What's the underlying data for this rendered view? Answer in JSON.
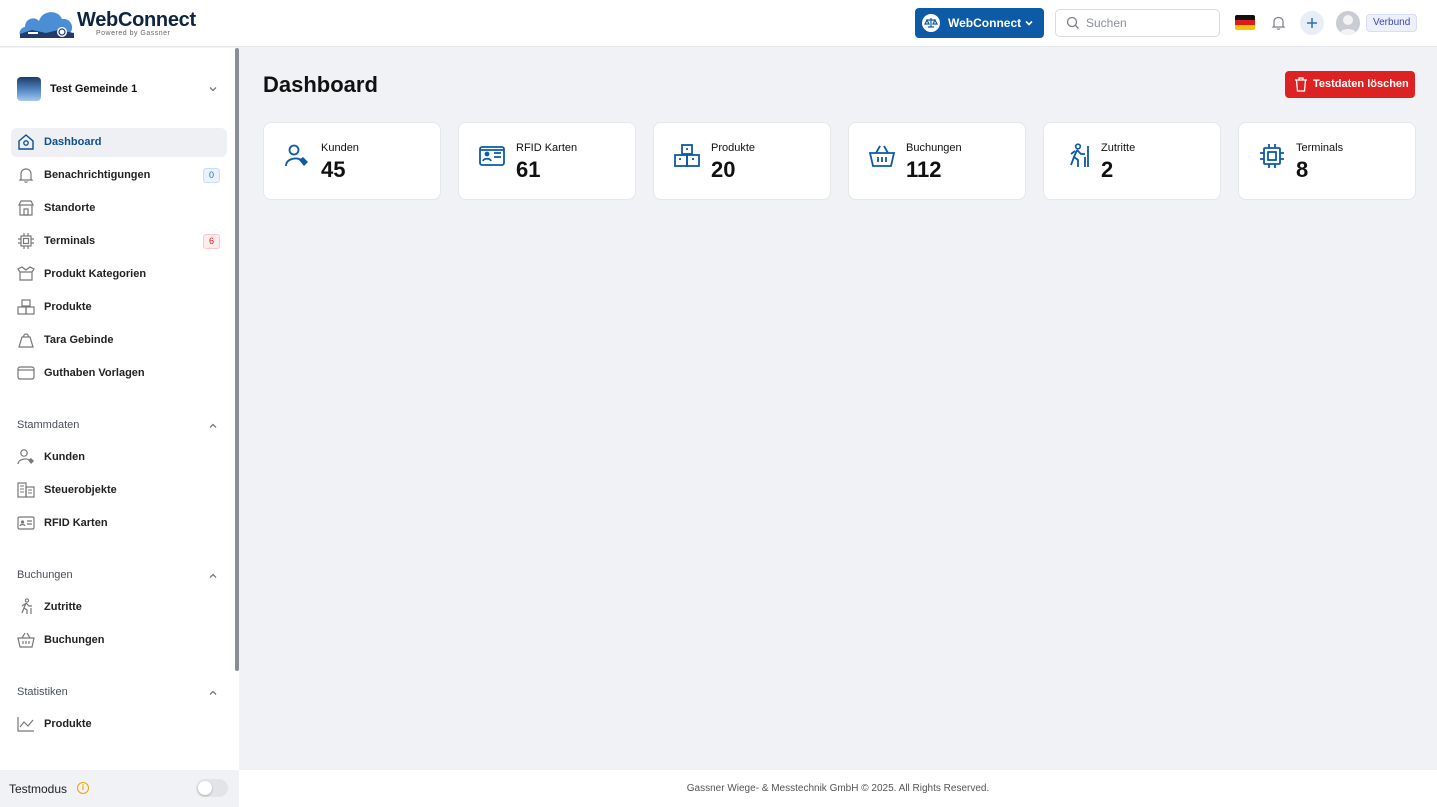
{
  "header": {
    "logo_title": "WebConnect",
    "logo_sub": "Powered by Gassner",
    "app_switch_label": "WebConnect",
    "search_placeholder": "Suchen",
    "verbund_label": "Verbund"
  },
  "sidebar": {
    "tenant_name": "Test Gemeinde 1",
    "items": [
      {
        "label": "Dashboard",
        "icon": "home-icon"
      },
      {
        "label": "Benachrichtigungen",
        "icon": "bell-icon",
        "badge": "0"
      },
      {
        "label": "Standorte",
        "icon": "store-icon"
      },
      {
        "label": "Terminals",
        "icon": "chip-icon",
        "badge": "6"
      },
      {
        "label": "Produkt Kategorien",
        "icon": "box-open-icon"
      },
      {
        "label": "Produkte",
        "icon": "boxes-icon"
      },
      {
        "label": "Tara Gebinde",
        "icon": "bag-icon"
      },
      {
        "label": "Guthaben Vorlagen",
        "icon": "wallet-icon"
      }
    ],
    "sections": [
      {
        "title": "Stammdaten",
        "items": [
          {
            "label": "Kunden",
            "icon": "user-tag-icon"
          },
          {
            "label": "Steuerobjekte",
            "icon": "building-icon"
          },
          {
            "label": "RFID Karten",
            "icon": "id-card-icon"
          }
        ]
      },
      {
        "title": "Buchungen",
        "items": [
          {
            "label": "Zutritte",
            "icon": "person-walking-icon"
          },
          {
            "label": "Buchungen",
            "icon": "basket-icon"
          }
        ]
      },
      {
        "title": "Statistiken",
        "items": [
          {
            "label": "Produkte",
            "icon": "chart-line-icon"
          }
        ]
      }
    ],
    "testmodus_label": "Testmodus"
  },
  "main": {
    "title": "Dashboard",
    "delete_button": "Testdaten löschen",
    "cards": [
      {
        "label": "Kunden",
        "value": "45",
        "icon": "user-tag-icon"
      },
      {
        "label": "RFID Karten",
        "value": "61",
        "icon": "id-card-icon"
      },
      {
        "label": "Produkte",
        "value": "20",
        "icon": "boxes-icon"
      },
      {
        "label": "Buchungen",
        "value": "112",
        "icon": "basket-icon"
      },
      {
        "label": "Zutritte",
        "value": "2",
        "icon": "person-walking-icon"
      },
      {
        "label": "Terminals",
        "value": "8",
        "icon": "chip-icon"
      }
    ]
  },
  "footer": {
    "text": "Gassner Wiege- & Messtechnik GmbH © 2025. All Rights Reserved."
  },
  "colors": {
    "primary": "#0d5aa7",
    "danger": "#dc2222",
    "background": "#f1f2f6",
    "card_icon": "#0d5aa7"
  }
}
